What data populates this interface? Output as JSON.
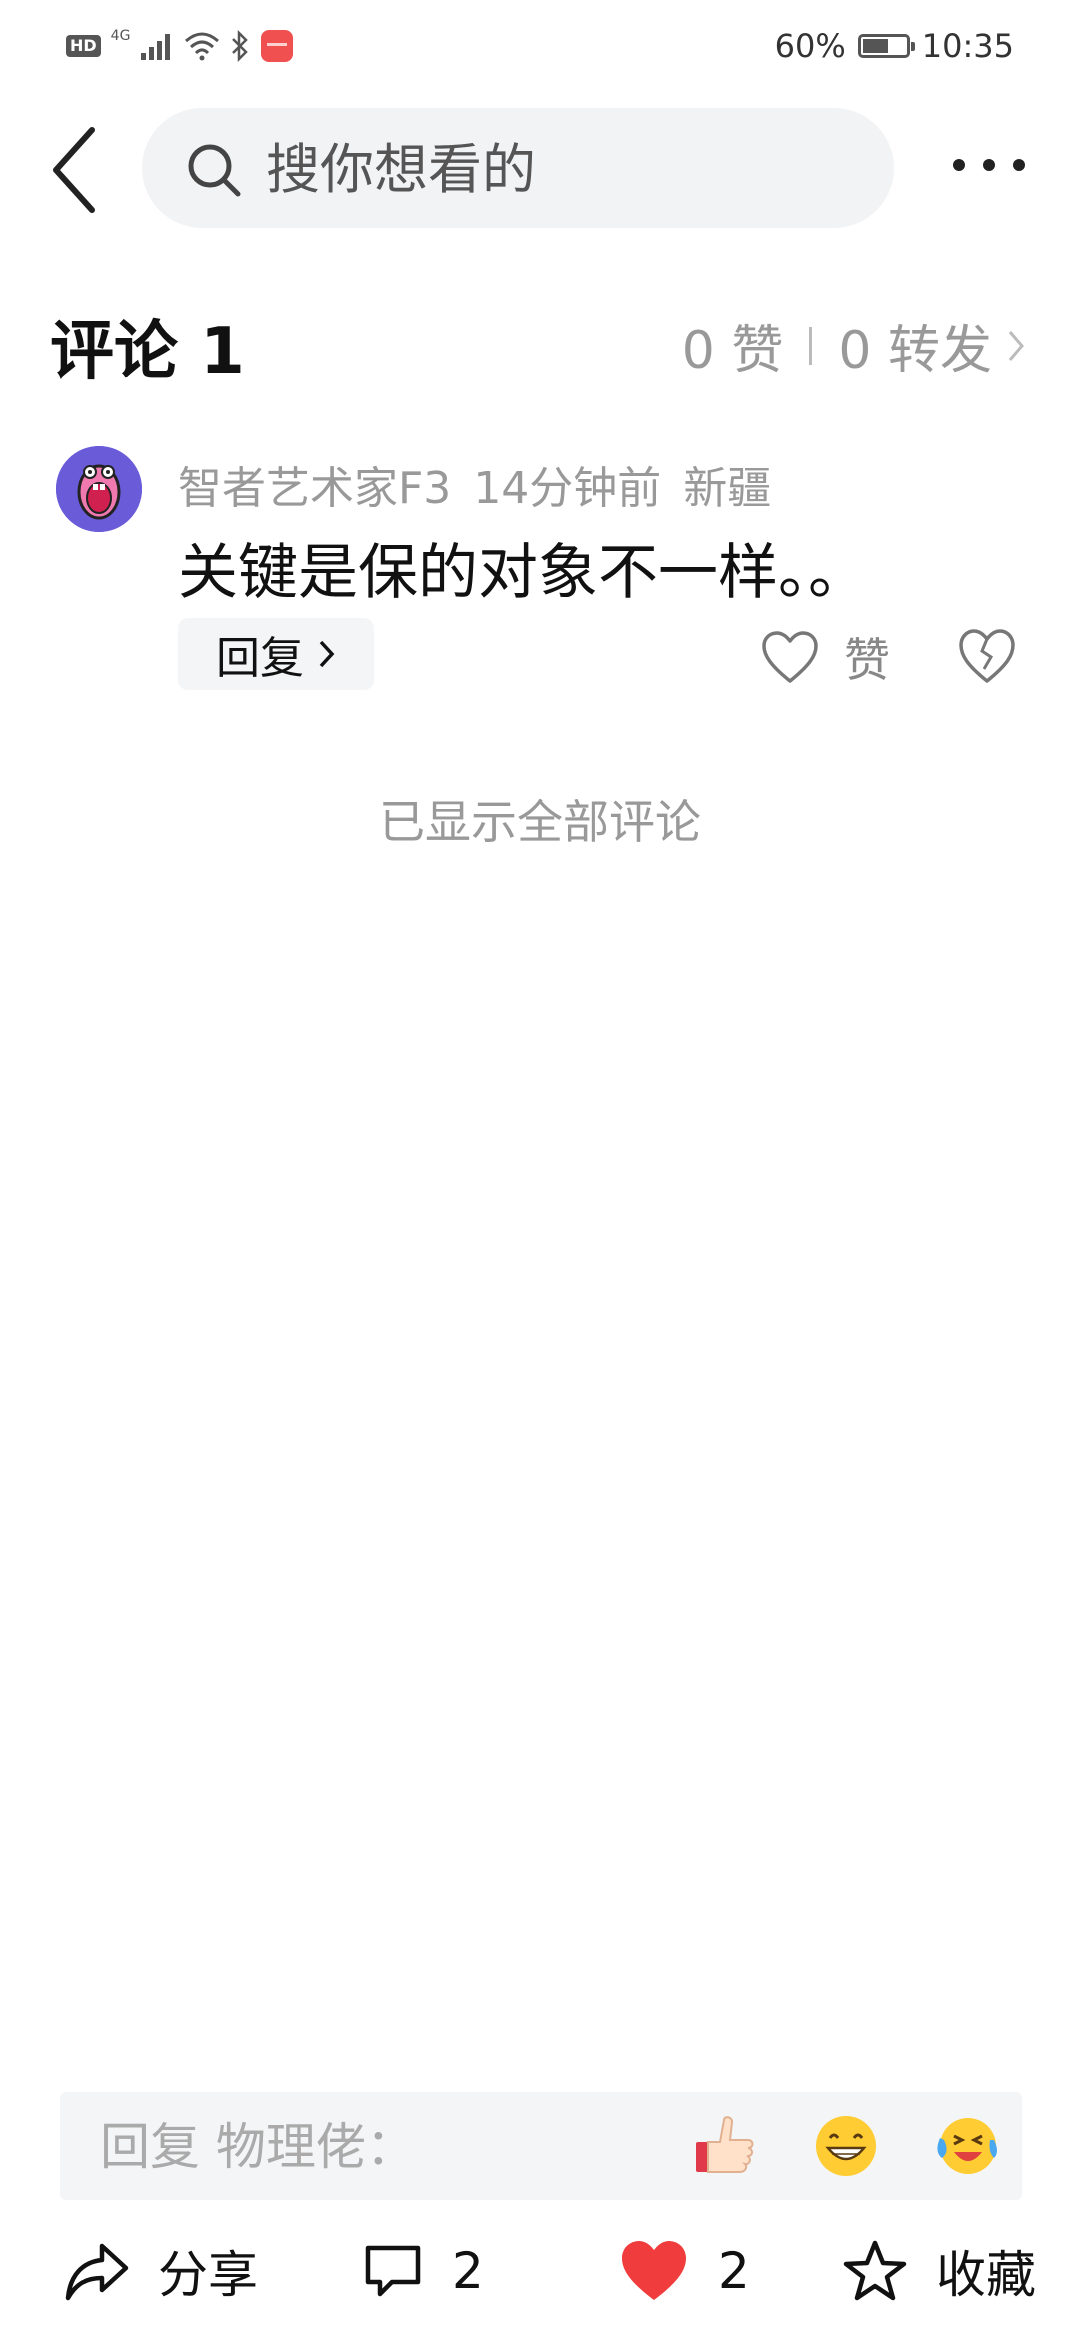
{
  "status_bar": {
    "hd_label": "HD",
    "network": "4G",
    "battery": "60%",
    "battery_level": 0.6,
    "time": "10:35"
  },
  "search": {
    "placeholder": "搜你想看的"
  },
  "comments_header": {
    "title": "评论 1",
    "likes": "0 赞",
    "reposts": "0 转发"
  },
  "comment": {
    "author": "智者艺术家F3",
    "time": "14分钟前",
    "location": "新疆",
    "text": "关键是保的对象不一样。。",
    "reply_label": "回复",
    "like_label": "赞"
  },
  "all_shown": "已显示全部评论",
  "reply_bar": {
    "placeholder": "回复 物理佬："
  },
  "bottom_bar": {
    "share_label": "分享",
    "comment_count": "2",
    "like_count": "2",
    "favorite_label": "收藏"
  },
  "colors": {
    "heart_red": "#f03c3c",
    "avatar_bg": "#6a5bd8"
  }
}
